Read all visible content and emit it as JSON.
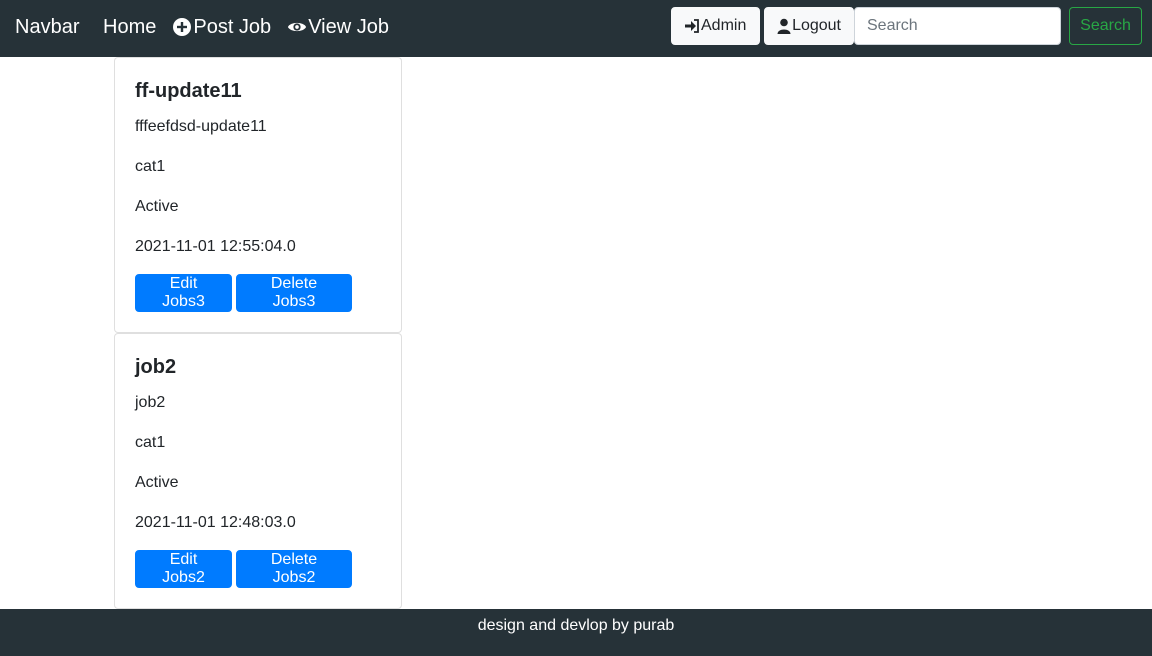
{
  "navbar": {
    "brand": "Navbar",
    "links": [
      {
        "label": "Home",
        "icon": "none"
      },
      {
        "label": "Post Job",
        "icon": "plus-circle-icon"
      },
      {
        "label": "View Job",
        "icon": "eye-icon"
      }
    ],
    "admin_label": "Admin",
    "logout_label": "Logout",
    "search_placeholder": "Search",
    "search_button_label": "Search"
  },
  "jobs": [
    {
      "title": "ff-update11",
      "description": "fffeefdsd-update11",
      "category": "cat1",
      "status": "Active",
      "date": "2021-11-01 12:55:04.0",
      "edit_label": "Edit Jobs3",
      "delete_label": "Delete Jobs3"
    },
    {
      "title": "job2",
      "description": "job2",
      "category": "cat1",
      "status": "Active",
      "date": "2021-11-01 12:48:03.0",
      "edit_label": "Edit Jobs2",
      "delete_label": "Delete Jobs2"
    }
  ],
  "footer": {
    "text": "design and devlop by purab"
  },
  "colors": {
    "navbar_bg": "#263238",
    "primary": "#007bff",
    "success": "#28a745",
    "light": "#f8f9fa"
  }
}
